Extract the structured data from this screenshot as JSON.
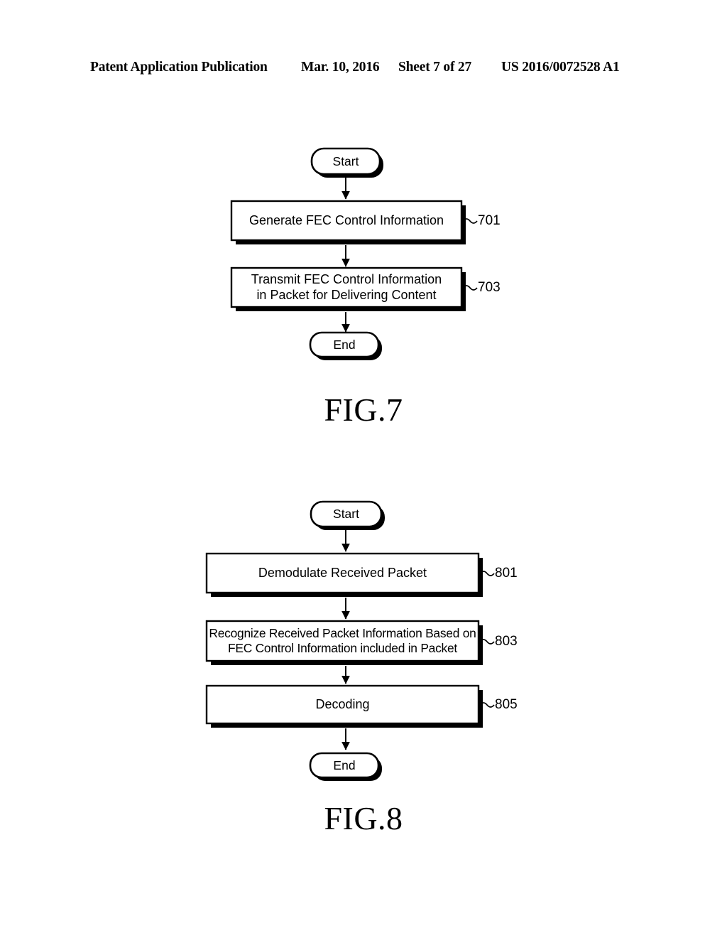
{
  "header": {
    "publication": "Patent Application Publication",
    "date": "Mar. 10, 2016",
    "sheet": "Sheet 7 of 27",
    "document_number": "US 2016/0072528 A1"
  },
  "figures": [
    {
      "id": "figure-7",
      "caption": "FIG.7",
      "start_label": "Start",
      "end_label": "End",
      "steps": [
        {
          "ref": "701",
          "lines": [
            "Generate FEC Control Information"
          ]
        },
        {
          "ref": "703",
          "lines": [
            "Transmit FEC Control Information",
            "in Packet for Delivering Content"
          ]
        }
      ]
    },
    {
      "id": "figure-8",
      "caption": "FIG.8",
      "start_label": "Start",
      "end_label": "End",
      "steps": [
        {
          "ref": "801",
          "lines": [
            "Demodulate Received Packet"
          ]
        },
        {
          "ref": "803",
          "lines": [
            "Recognize Received Packet Information Based on",
            "FEC Control Information included in Packet"
          ]
        },
        {
          "ref": "805",
          "lines": [
            "Decoding"
          ]
        }
      ]
    }
  ],
  "colors": {
    "ink": "#000000",
    "paper": "#ffffff"
  }
}
